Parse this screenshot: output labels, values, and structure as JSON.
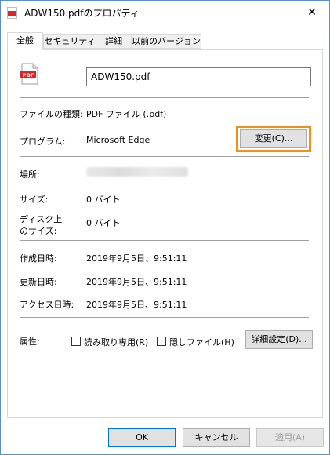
{
  "window": {
    "title": "ADW150.pdfのプロパティ",
    "close_glyph": "✕",
    "app_icon_label": "PDF"
  },
  "tabs": [
    {
      "label": "全般",
      "active": true
    },
    {
      "label": "セキュリティ",
      "active": false
    },
    {
      "label": "詳細",
      "active": false
    },
    {
      "label": "以前のバージョン",
      "active": false
    }
  ],
  "general": {
    "file_icon_label": "PDF",
    "file_name": "ADW150.pdf",
    "file_type_label": "ファイルの種類:",
    "file_type_value": "PDF ファイル (.pdf)",
    "program_label": "プログラム:",
    "program_value": "Microsoft Edge",
    "change_button": "変更(C)...",
    "location_label": "場所:",
    "size_label": "サイズ:",
    "size_value": "0 バイト",
    "disk_size_label_1": "ディスク上",
    "disk_size_label_2": "のサイズ:",
    "disk_size_value": "0 バイト",
    "created_label": "作成日時:",
    "created_value": "2019年9月5日、9:51:11",
    "modified_label": "更新日時:",
    "modified_value": "2019年9月5日、9:51:11",
    "accessed_label": "アクセス日時:",
    "accessed_value": "2019年9月5日、9:51:11",
    "attributes_label": "属性:",
    "readonly_label": "読み取り専用(R)",
    "hidden_label": "隠しファイル(H)",
    "advanced_button": "詳細設定(D)..."
  },
  "footer": {
    "ok": "OK",
    "cancel": "キャンセル",
    "apply": "適用(A)"
  },
  "colors": {
    "highlight": "#f0901a",
    "pdf_red": "#d9252a",
    "primary_border": "#0078d7"
  }
}
